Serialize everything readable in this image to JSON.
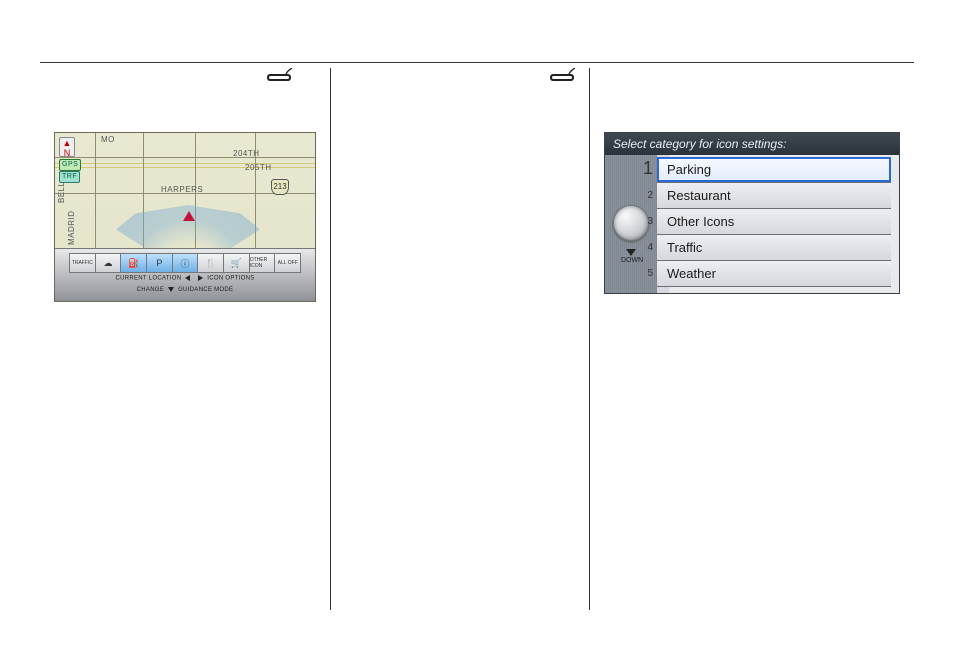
{
  "left": {
    "map": {
      "compass": "N",
      "gps_badge": "GPS",
      "trf_badge": "TRF",
      "streets": {
        "mo": "MO",
        "harpers": "HARPERS",
        "bell": "BELL",
        "madrid": "MADRID",
        "s204": "204TH",
        "s205": "205TH"
      },
      "shield": "213",
      "toolbar": {
        "icons": {
          "traffic": "TRAFFIC",
          "weather": "☁",
          "gas": "⛽",
          "parking": "P",
          "info": "ⓘ",
          "food": "🍴",
          "shopping": "🛒",
          "other": "OTHER ICON",
          "alloff": "ALL OFF"
        },
        "line1_left": "CURRENT LOCATION",
        "line1_right": "ICON OPTIONS",
        "line2_left": "CHANGE",
        "line2_right": "GUIDANCE MODE"
      }
    }
  },
  "right": {
    "settings": {
      "title": "Select category for icon settings:",
      "down_label": "DOWN",
      "items": [
        {
          "label": "Parking",
          "selected": true
        },
        {
          "label": "Restaurant",
          "selected": false
        },
        {
          "label": "Other Icons",
          "selected": false
        },
        {
          "label": "Traffic",
          "selected": false
        },
        {
          "label": "Weather",
          "selected": false
        }
      ]
    }
  }
}
